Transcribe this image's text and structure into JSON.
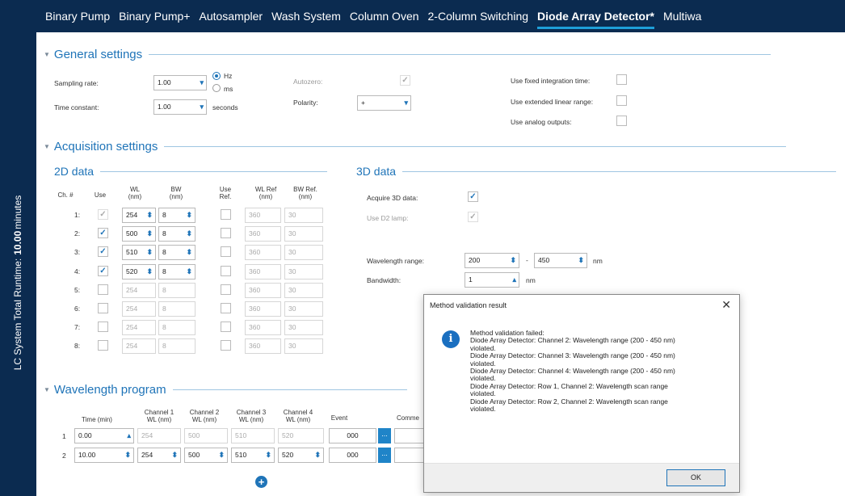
{
  "sidebar": {
    "label": "LC System Total Runtime:",
    "runtime": "10.00",
    "unit": "minutes"
  },
  "tabs": [
    {
      "label": "Binary Pump"
    },
    {
      "label": "Binary Pump+"
    },
    {
      "label": "Autosampler"
    },
    {
      "label": "Wash System"
    },
    {
      "label": "Column Oven"
    },
    {
      "label": "2-Column Switching"
    },
    {
      "label": "Diode Array Detector*"
    },
    {
      "label": "Multiwa"
    }
  ],
  "general": {
    "title": "General settings",
    "sampling_rate_label": "Sampling rate:",
    "sampling_rate": "1.00",
    "hz": "Hz",
    "ms": "ms",
    "time_constant_label": "Time constant:",
    "time_constant": "1.00",
    "seconds": "seconds",
    "autozero_label": "Autozero:",
    "polarity_label": "Polarity:",
    "polarity": "+",
    "fixed_int_label": "Use fixed integration time:",
    "ext_linear_label": "Use extended linear range:",
    "analog_label": "Use analog outputs:"
  },
  "acq": {
    "title": "Acquisition settings"
  },
  "data2d": {
    "title": "2D data",
    "headers": {
      "ch": "Ch. #",
      "use": "Use",
      "wl": "WL\n(nm)",
      "bw": "BW\n(nm)",
      "useref": "Use\nRef.",
      "wlref": "WL Ref\n(nm)",
      "bwref": "BW Ref.\n(nm)"
    },
    "rows": [
      {
        "ch": "1:",
        "wl": "254",
        "bw": "8",
        "wlref": "360",
        "bwref": "30"
      },
      {
        "ch": "2:",
        "wl": "500",
        "bw": "8",
        "wlref": "360",
        "bwref": "30"
      },
      {
        "ch": "3:",
        "wl": "510",
        "bw": "8",
        "wlref": "360",
        "bwref": "30"
      },
      {
        "ch": "4:",
        "wl": "520",
        "bw": "8",
        "wlref": "360",
        "bwref": "30"
      },
      {
        "ch": "5:",
        "wl": "254",
        "bw": "8",
        "wlref": "360",
        "bwref": "30"
      },
      {
        "ch": "6:",
        "wl": "254",
        "bw": "8",
        "wlref": "360",
        "bwref": "30"
      },
      {
        "ch": "7:",
        "wl": "254",
        "bw": "8",
        "wlref": "360",
        "bwref": "30"
      },
      {
        "ch": "8:",
        "wl": "254",
        "bw": "8",
        "wlref": "360",
        "bwref": "30"
      }
    ]
  },
  "data3d": {
    "title": "3D data",
    "acquire_label": "Acquire 3D data:",
    "d2_label": "Use D2 lamp:",
    "wl_range_label": "Wavelength range:",
    "wl_from": "200",
    "dash": "-",
    "wl_to": "450",
    "nm": "nm",
    "bandwidth_label": "Bandwidth:",
    "bandwidth": "1"
  },
  "wlprog": {
    "title": "Wavelength program",
    "headers": {
      "time": "Time (min)",
      "ch1": "Channel 1\nWL (nm)",
      "ch2": "Channel 2\nWL (nm)",
      "ch3": "Channel 3\nWL (nm)",
      "ch4": "Channel 4\nWL (nm)",
      "event": "Event",
      "comment": "Comme"
    },
    "rows": [
      {
        "n": "1",
        "time": "0.00",
        "ch1": "254",
        "ch2": "500",
        "ch3": "510",
        "ch4": "520",
        "event": "000",
        "btn": "..."
      },
      {
        "n": "2",
        "time": "10.00",
        "ch1": "254",
        "ch2": "500",
        "ch3": "510",
        "ch4": "520",
        "event": "000",
        "btn": "..."
      }
    ],
    "add": "+"
  },
  "dialog": {
    "title": "Method validation result",
    "close": "✕",
    "icon": "i",
    "lines": [
      "Method validation failed:",
      "Diode Array Detector: Channel 2: Wavelength range (200 - 450 nm)",
      "violated.",
      "Diode Array Detector: Channel 3: Wavelength range (200 - 450 nm)",
      "violated.",
      "Diode Array Detector: Channel 4: Wavelength range (200 - 450 nm)",
      "violated.",
      "Diode Array Detector: Row 1, Channel 2: Wavelength scan range",
      "violated.",
      "Diode Array Detector: Row 2, Channel 2: Wavelength scan range",
      "violated."
    ],
    "ok": "OK"
  }
}
